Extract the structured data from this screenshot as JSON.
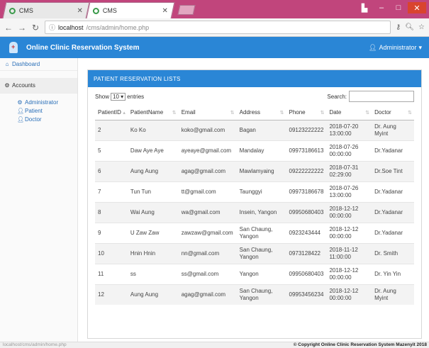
{
  "browser": {
    "tabs": [
      {
        "title": "CMS",
        "active": false
      },
      {
        "title": "CMS",
        "active": true
      }
    ],
    "url_host": "localhost",
    "url_path": "/cms/admin/home.php"
  },
  "header": {
    "brand": "Online Clinic Reservation System",
    "user": "Administrator"
  },
  "sidebar": {
    "dashboard": "Dashboard",
    "accounts": "Accounts",
    "sub_items": [
      "Administrator",
      "Patient",
      "Doctor"
    ]
  },
  "panel": {
    "title": "PATIENT RESERVATION LISTS",
    "show_label": "Show",
    "entries_value": "10",
    "entries_label": "entries",
    "search_label": "Search:"
  },
  "table": {
    "columns": [
      "PatientID",
      "PatientName",
      "Email",
      "Address",
      "Phone",
      "Date",
      "Doctor"
    ],
    "rows": [
      [
        "2",
        "Ko Ko",
        "koko@gmail.com",
        "Bagan",
        "09123222222",
        "2018-07-20 13:00:00",
        "Dr. Aung Myint"
      ],
      [
        "5",
        "Daw Aye Aye",
        "ayeaye@gmail.com",
        "Mandalay",
        "09973186613",
        "2018-07-26 00:00:00",
        "Dr.Yadanar"
      ],
      [
        "6",
        "Aung Aung",
        "agag@gmail.com",
        "Mawlamyaing",
        "09222222222",
        "2018-07-31 02:29:00",
        "Dr.Soe Tint"
      ],
      [
        "7",
        "Tun Tun",
        "tt@gmail.com",
        "Taunggyi",
        "09973186678",
        "2018-07-26 13:00:00",
        "Dr.Yadanar"
      ],
      [
        "8",
        "Wai Aung",
        "wa@gmail.com",
        "Insein, Yangon",
        "09950680403",
        "2018-12-12 00:00:00",
        "Dr.Yadanar"
      ],
      [
        "9",
        "U Zaw Zaw",
        "zawzaw@gmail.com",
        "San Chaung, Yangon",
        "0923243444",
        "2018-12-12 00:00:00",
        "Dr.Yadanar"
      ],
      [
        "10",
        "Hnin Hnin",
        "nn@gmail.com",
        "San Chaung, Yangon",
        "0973128422",
        "2018-11-12 11:00:00",
        "Dr. Smith"
      ],
      [
        "11",
        "ss",
        "ss@gmail.com",
        "Yangon",
        "09950680403",
        "2018-12-12 00:00:00",
        "Dr. Yin Yin"
      ],
      [
        "12",
        "Aung Aung",
        "agag@gmail.com",
        "San Chaung, Yangon",
        "09953456234",
        "2018-12-12 00:00:00",
        "Dr. Aung Myint"
      ]
    ]
  },
  "footer": {
    "status_url": "localhost/cms/admin/home.php",
    "copyright": "© Copyright Online Clinic Reservation System Mazenyit 2018"
  }
}
